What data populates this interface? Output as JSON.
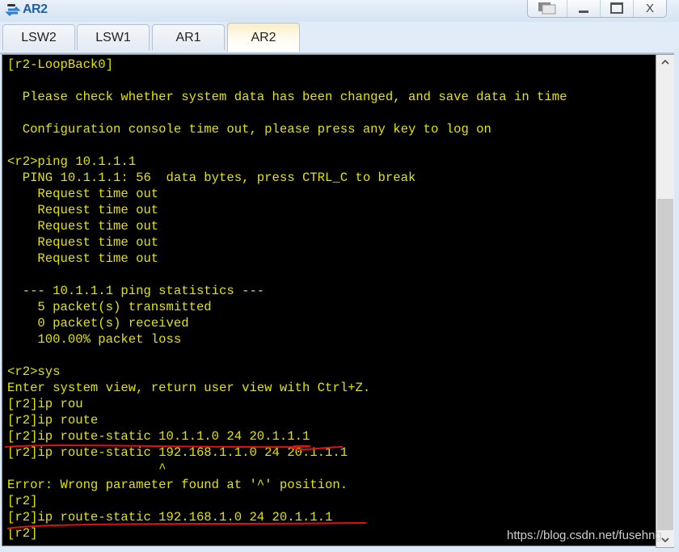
{
  "window": {
    "title": "AR2",
    "icon": "router-network-icon",
    "controls": {
      "restore_icon": "switch-windows-icon",
      "minimize_label": "_",
      "maximize_label": "☐",
      "close_label": "X"
    }
  },
  "tabs": [
    {
      "label": "LSW2",
      "active": false
    },
    {
      "label": "LSW1",
      "active": false
    },
    {
      "label": "AR1",
      "active": false
    },
    {
      "label": "AR2",
      "active": true
    }
  ],
  "terminal": {
    "text_color": "#e3e300",
    "background": "#000000",
    "lines": [
      "[r2-LoopBack0]",
      "",
      "  Please check whether system data has been changed, and save data in time",
      "",
      "  Configuration console time out, please press any key to log on",
      "",
      "<r2>ping 10.1.1.1",
      "  PING 10.1.1.1: 56  data bytes, press CTRL_C to break",
      "    Request time out",
      "    Request time out",
      "    Request time out",
      "    Request time out",
      "    Request time out",
      "",
      "  --- 10.1.1.1 ping statistics ---",
      "    5 packet(s) transmitted",
      "    0 packet(s) received",
      "    100.00% packet loss",
      "",
      "<r2>sys",
      "Enter system view, return user view with Ctrl+Z.",
      "[r2]ip rou",
      "[r2]ip route",
      "[r2]ip route-static 10.1.1.0 24 20.1.1.1",
      "[r2]ip route-static 192.168.1.1.0 24 20.1.1.1",
      "                    ^",
      "Error: Wrong parameter found at '^' position.",
      "[r2]",
      "[r2]ip route-static 192.168.1.0 24 20.1.1.1",
      "[r2]"
    ],
    "annotation_color": "#e01010"
  },
  "scrollbar": {
    "up_icon": "^",
    "down_icon": "v"
  },
  "watermark": "https://blog.csdn.net/fusehng"
}
